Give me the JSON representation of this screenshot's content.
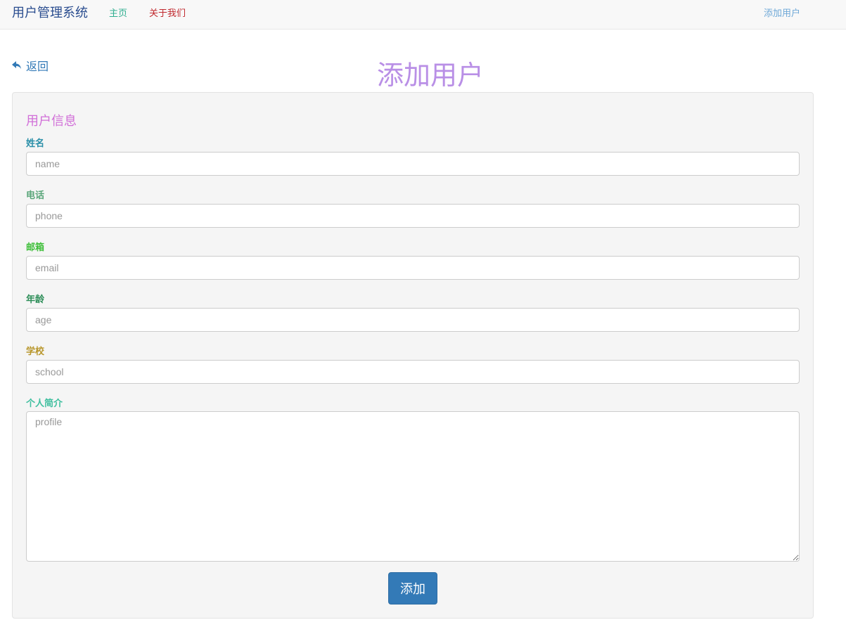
{
  "navbar": {
    "brand": "用户管理系统",
    "links": [
      {
        "label": "主页",
        "color": "#2fae8f"
      },
      {
        "label": "关于我们",
        "color": "#c0282d"
      }
    ],
    "right_link": {
      "label": "添加用户",
      "color": "#6ea8d7"
    }
  },
  "back": {
    "label": "返回",
    "icon": "reply-arrow-icon"
  },
  "page_title": "添加用户",
  "form": {
    "legend": "用户信息",
    "fields": [
      {
        "label": "姓名",
        "placeholder": "name",
        "color": "#2a8fa8"
      },
      {
        "label": "电话",
        "placeholder": "phone",
        "color": "#5aa67a"
      },
      {
        "label": "邮箱",
        "placeholder": "email",
        "color": "#3fbf3a"
      },
      {
        "label": "年龄",
        "placeholder": "age",
        "color": "#2f8f5a"
      },
      {
        "label": "学校",
        "placeholder": "school",
        "color": "#b8962a"
      },
      {
        "label": "个人简介",
        "placeholder": "profile",
        "color": "#3fbf9f"
      }
    ],
    "submit_label": "添加"
  },
  "colors": {
    "title": "#b98fe6",
    "legend": "#d16fd8",
    "primary": "#337ab7"
  }
}
